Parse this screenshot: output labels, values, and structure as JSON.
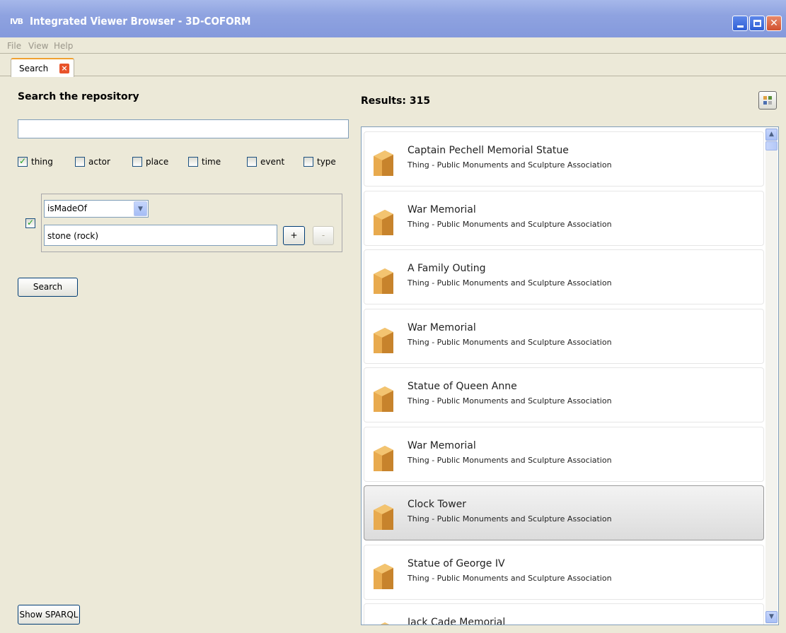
{
  "window": {
    "app_icon_text": "IVB",
    "title": "Integrated Viewer Browser - 3D-COFORM"
  },
  "menu": [
    "File",
    "View",
    "Help"
  ],
  "tabs": [
    {
      "label": "Search",
      "close": "×"
    }
  ],
  "search_panel": {
    "heading": "Search the repository",
    "query_value": "",
    "filters": [
      {
        "label": "thing",
        "checked": true
      },
      {
        "label": "actor",
        "checked": false
      },
      {
        "label": "place",
        "checked": false
      },
      {
        "label": "time",
        "checked": false
      },
      {
        "label": "event",
        "checked": false
      },
      {
        "label": "type",
        "checked": false
      }
    ],
    "condition": {
      "enabled": true,
      "property": "isMadeOf",
      "value": "stone (rock)",
      "add_label": "+",
      "remove_label": "-"
    },
    "search_button": "Search",
    "sparql_button": "Show SPARQL"
  },
  "results": {
    "title": "Results: 315",
    "items": [
      {
        "title": "Captain Pechell Memorial Statue",
        "subtitle": "Thing - Public Monuments and Sculpture Association"
      },
      {
        "title": "War Memorial",
        "subtitle": "Thing - Public Monuments and Sculpture Association"
      },
      {
        "title": "A Family Outing",
        "subtitle": "Thing - Public Monuments and Sculpture Association"
      },
      {
        "title": "War Memorial",
        "subtitle": "Thing - Public Monuments and Sculpture Association"
      },
      {
        "title": "Statue of Queen Anne",
        "subtitle": "Thing - Public Monuments and Sculpture Association"
      },
      {
        "title": "War Memorial",
        "subtitle": "Thing - Public Monuments and Sculpture Association"
      },
      {
        "title": "Clock Tower",
        "subtitle": "Thing - Public Monuments and Sculpture Association",
        "selected": true
      },
      {
        "title": "Statue of George IV",
        "subtitle": "Thing - Public Monuments and Sculpture Association"
      },
      {
        "title": "Jack Cade Memorial",
        "subtitle": ""
      }
    ]
  },
  "colors": {
    "titlebar": "#8fa3e0",
    "window_bg": "#ece9d8",
    "tab_accent": "#f0a030",
    "close_red": "#e8532a",
    "checkmark_green": "#21a121",
    "item_icon": "#e0a040"
  },
  "icons": {
    "result_item": "cube-icon",
    "view_toggle": "grid-icon"
  }
}
